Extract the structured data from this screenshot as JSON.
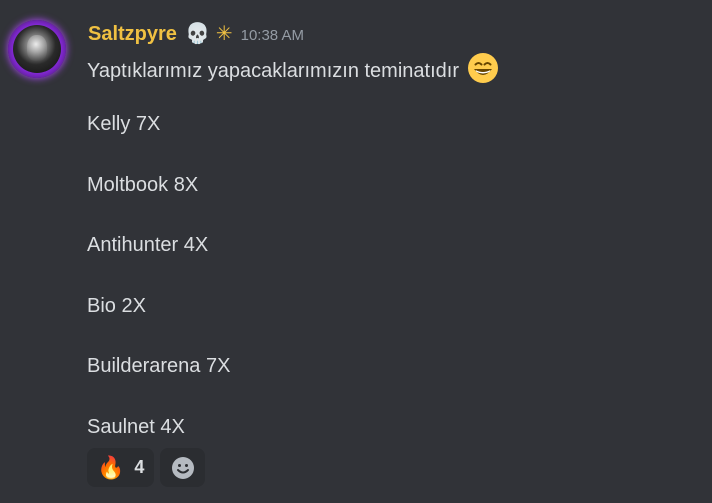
{
  "message": {
    "author": "Saltzpyre",
    "badges": [
      "💀",
      "✳"
    ],
    "timestamp": "10:38 AM",
    "lines": [
      "Yaptıklarımız yapacaklarımızın teminatıdır",
      "Kelly 7X",
      "Moltbook 8X",
      "Antihunter 4X",
      "Bio 2X",
      "Builderarena 7X",
      "Saulnet 4X"
    ],
    "inline_emoji": "grinning-face-with-smiling-eyes",
    "reactions": [
      {
        "emoji": "🔥",
        "count": "4"
      }
    ],
    "add_reaction_icon": "smiley-add-reaction-icon"
  }
}
